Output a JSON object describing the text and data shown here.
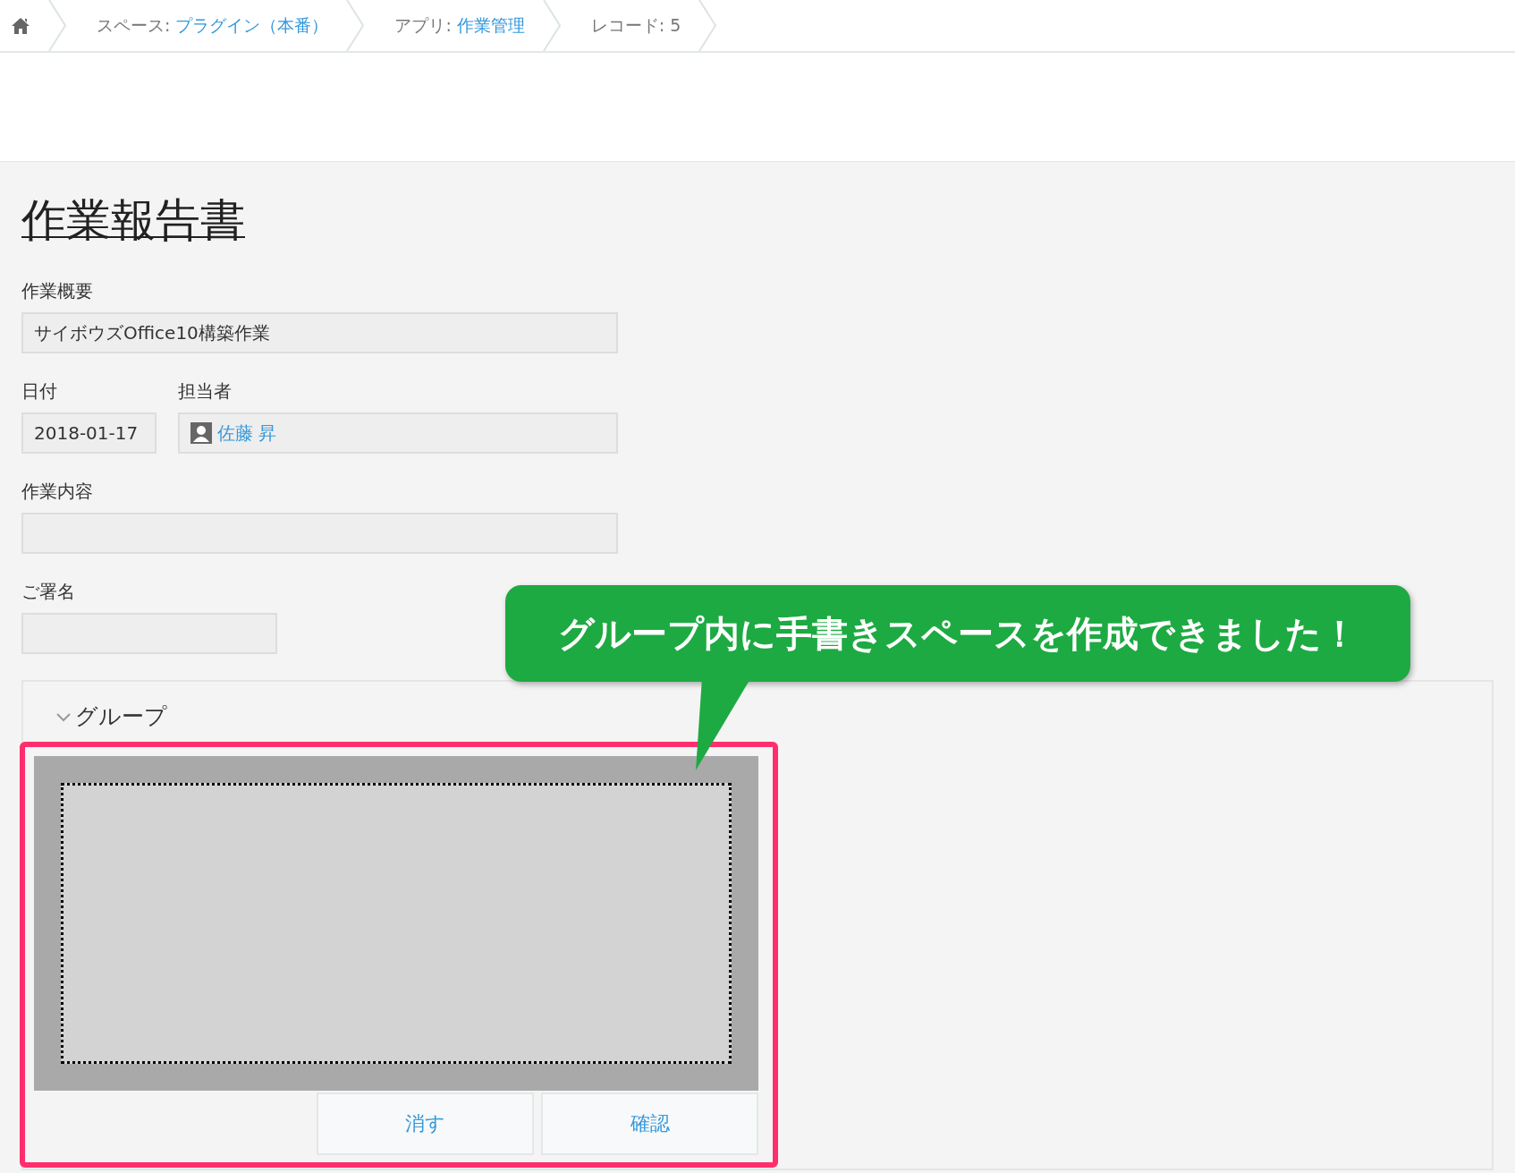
{
  "breadcrumb": [
    {
      "prefix": "スペース:",
      "link": "プラグイン（本番）"
    },
    {
      "prefix": "アプリ:",
      "link": "作業管理"
    },
    {
      "prefix": "レコード: 5"
    }
  ],
  "title": "作業報告書",
  "rows": [
    {
      "fields": [
        {
          "label": "作業概要",
          "value": "サイボウズOffice10構築作業",
          "kind": "text"
        }
      ]
    },
    {
      "fields": [
        {
          "label": "日付",
          "value": "2018-01-17",
          "kind": "date"
        },
        {
          "label": "担当者",
          "value": "佐藤 昇",
          "kind": "user"
        }
      ]
    },
    {
      "fields": [
        {
          "label": "作業内容",
          "kind": "text"
        }
      ]
    },
    {
      "fields": [
        {
          "label": "ご署名",
          "kind": "signature"
        }
      ]
    }
  ],
  "group": {
    "label": "グループ",
    "expanded": true,
    "buttons": [
      "消す",
      "確認"
    ]
  },
  "callout": "グループ内に手書きスペースを作成できました！"
}
